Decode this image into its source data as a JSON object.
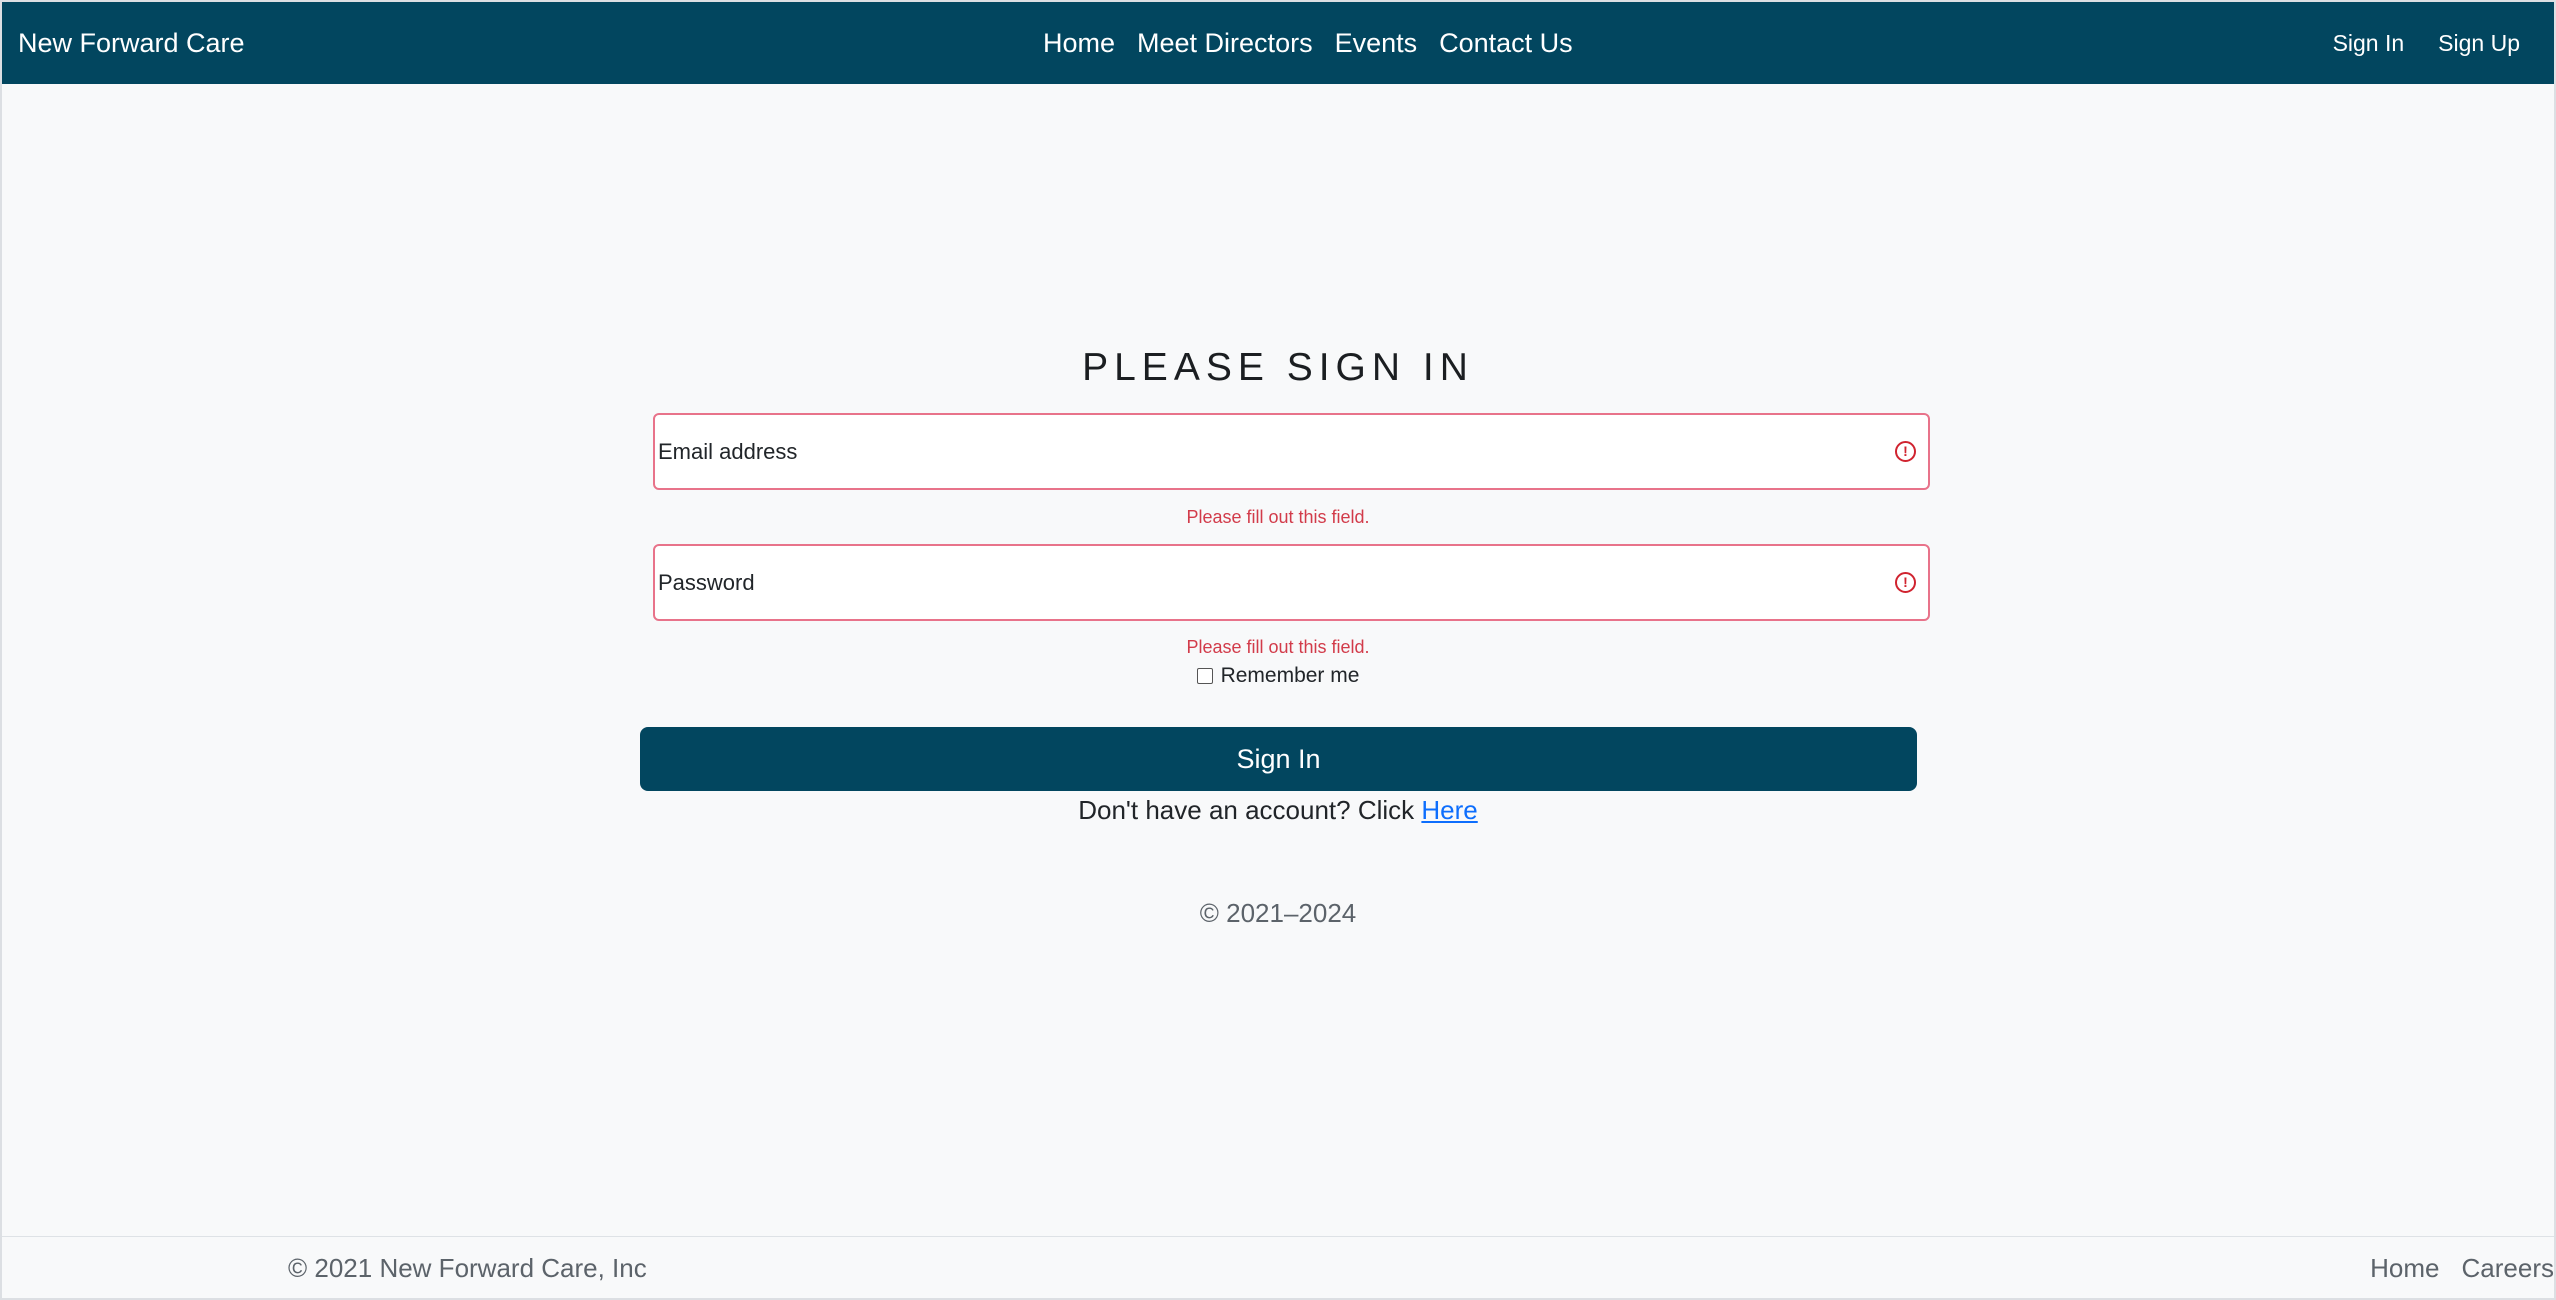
{
  "navbar": {
    "brand": "New Forward Care",
    "links": [
      "Home",
      "Meet Directors",
      "Events",
      "Contact Us"
    ],
    "auth": {
      "sign_in": "Sign In",
      "sign_up": "Sign Up"
    }
  },
  "form": {
    "title": "PLEASE SIGN IN",
    "email_placeholder": "Email address",
    "email_error": "Please fill out this field.",
    "password_placeholder": "Password",
    "password_error": "Please fill out this field.",
    "remember_label": "Remember me",
    "remember_checked": false,
    "submit_label": "Sign In",
    "account_prompt": "Don't have an account? Click ",
    "account_link": "Here",
    "copyright": "© 2021–2024"
  },
  "footer": {
    "copyright": "© 2021 New Forward Care, Inc",
    "links": [
      "Home",
      "Careers"
    ]
  },
  "colors": {
    "primary": "#02465f",
    "error": "#d0232f",
    "link": "#0d6efd"
  }
}
